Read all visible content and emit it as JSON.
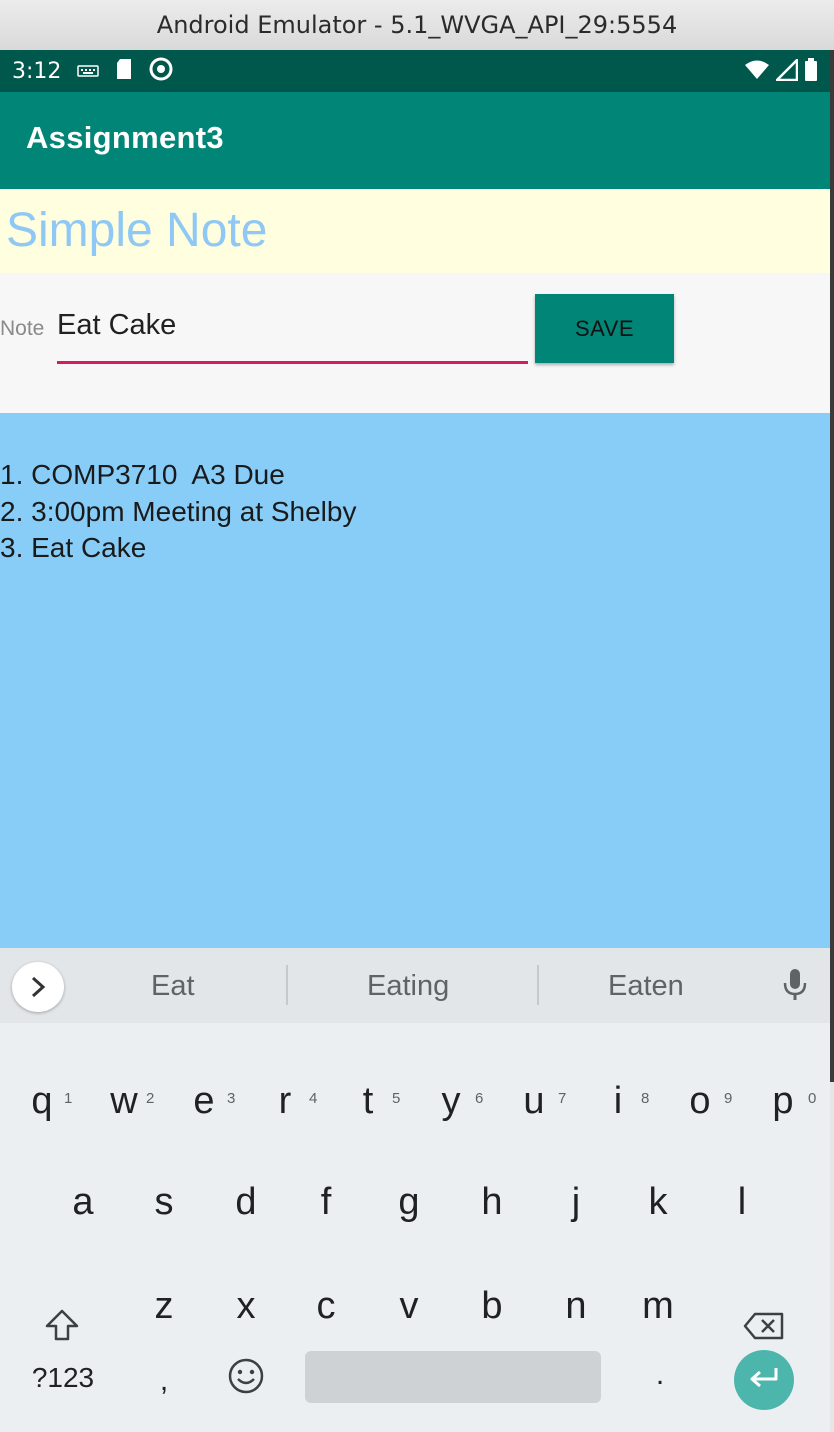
{
  "window": {
    "title": "Android Emulator - 5.1_WVGA_API_29:5554"
  },
  "status_bar": {
    "time": "3:12"
  },
  "app_bar": {
    "title": "Assignment3"
  },
  "header": {
    "title": "Simple Note"
  },
  "note_form": {
    "label": "Note",
    "value": "Eat Cake",
    "save_label": "SAVE"
  },
  "notes": [
    "1. COMP3710  A3 Due",
    "2. 3:00pm Meeting at Shelby",
    "3. Eat Cake"
  ],
  "keyboard": {
    "suggestions": [
      "Eat",
      "Eating",
      "Eaten"
    ],
    "row1": [
      "q",
      "w",
      "e",
      "r",
      "t",
      "y",
      "u",
      "i",
      "o",
      "p"
    ],
    "row1_hints": [
      "1",
      "2",
      "3",
      "4",
      "5",
      "6",
      "7",
      "8",
      "9",
      "0"
    ],
    "row2": [
      "a",
      "s",
      "d",
      "f",
      "g",
      "h",
      "j",
      "k",
      "l"
    ],
    "row3": [
      "z",
      "x",
      "c",
      "v",
      "b",
      "n",
      "m"
    ],
    "symbols_label": "?123",
    "comma": ",",
    "period": "."
  },
  "colors": {
    "status_bar": "#00574b",
    "app_bar": "#008577",
    "accent": "#d81b60",
    "notes_bg": "#87cdf8",
    "header_bg": "#ffffe0",
    "header_text": "#8fc8f5"
  }
}
